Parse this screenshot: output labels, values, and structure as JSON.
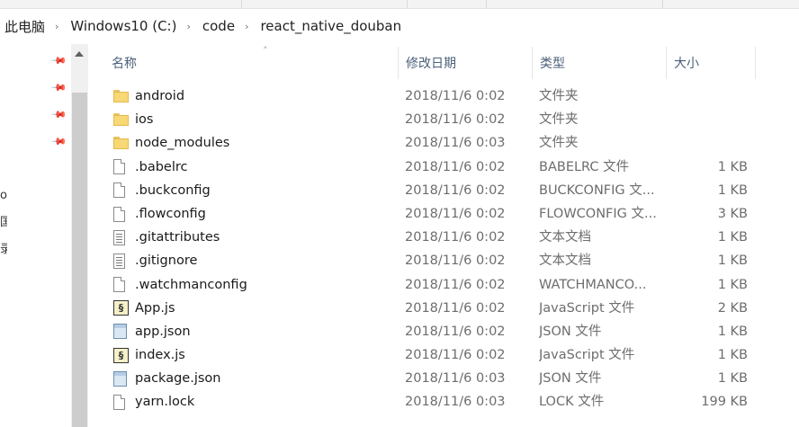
{
  "breadcrumb": [
    "此电脑",
    "Windows10 (C:)",
    "code",
    "react_native_douban"
  ],
  "breadcrumb_separator": "›",
  "nav_cut_labels": [
    "o",
    "国",
    "录"
  ],
  "columns": {
    "name": "名称",
    "date": "修改日期",
    "type": "类型",
    "size": "大小"
  },
  "files": [
    {
      "name": "android",
      "date": "2018/11/6 0:02",
      "type": "文件夹",
      "size": "",
      "icon": "folder-icon"
    },
    {
      "name": "ios",
      "date": "2018/11/6 0:02",
      "type": "文件夹",
      "size": "",
      "icon": "folder-icon"
    },
    {
      "name": "node_modules",
      "date": "2018/11/6 0:03",
      "type": "文件夹",
      "size": "",
      "icon": "folder-icon"
    },
    {
      "name": ".babelrc",
      "date": "2018/11/6 0:02",
      "type": "BABELRC 文件",
      "size": "1 KB",
      "icon": "file-icon"
    },
    {
      "name": ".buckconfig",
      "date": "2018/11/6 0:02",
      "type": "BUCKCONFIG 文...",
      "size": "1 KB",
      "icon": "file-icon"
    },
    {
      "name": ".flowconfig",
      "date": "2018/11/6 0:02",
      "type": "FLOWCONFIG 文...",
      "size": "3 KB",
      "icon": "file-icon"
    },
    {
      "name": ".gitattributes",
      "date": "2018/11/6 0:02",
      "type": "文本文档",
      "size": "1 KB",
      "icon": "text-file-icon"
    },
    {
      "name": ".gitignore",
      "date": "2018/11/6 0:02",
      "type": "文本文档",
      "size": "1 KB",
      "icon": "text-file-icon"
    },
    {
      "name": ".watchmanconfig",
      "date": "2018/11/6 0:02",
      "type": "WATCHMANCO...",
      "size": "1 KB",
      "icon": "file-icon"
    },
    {
      "name": "App.js",
      "date": "2018/11/6 0:02",
      "type": "JavaScript 文件",
      "size": "2 KB",
      "icon": "js-file-icon"
    },
    {
      "name": "app.json",
      "date": "2018/11/6 0:02",
      "type": "JSON 文件",
      "size": "1 KB",
      "icon": "json-file-icon"
    },
    {
      "name": "index.js",
      "date": "2018/11/6 0:02",
      "type": "JavaScript 文件",
      "size": "1 KB",
      "icon": "js-file-icon"
    },
    {
      "name": "package.json",
      "date": "2018/11/6 0:03",
      "type": "JSON 文件",
      "size": "1 KB",
      "icon": "json-file-icon"
    },
    {
      "name": "yarn.lock",
      "date": "2018/11/6 0:03",
      "type": "LOCK 文件",
      "size": "199 KB",
      "icon": "file-icon"
    }
  ]
}
